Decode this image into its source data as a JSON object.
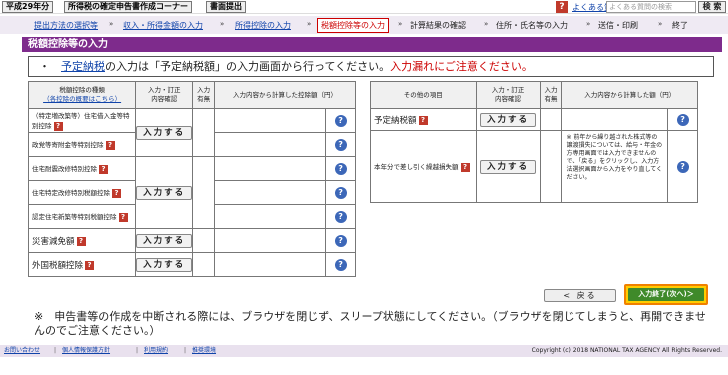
{
  "topbar": {
    "year_btn": "平成29年分",
    "corner_btn": "所得税の確定申告書作成コーナー",
    "print_btn": "書面提出",
    "faq_link": "よくある質問",
    "search_placeholder": "よくある質問の検索",
    "search_btn": "検 索"
  },
  "steps": [
    {
      "label": "提出方法の選択等",
      "state": "link"
    },
    {
      "label": "収入・所得金額の入力",
      "state": "link"
    },
    {
      "label": "所得控除の入力",
      "state": "link"
    },
    {
      "label": "税額控除等の入力",
      "state": "current"
    },
    {
      "label": "計算結果の確認",
      "state": "plain"
    },
    {
      "label": "住所・氏名等の入力",
      "state": "plain"
    },
    {
      "label": "送信・印刷",
      "state": "plain"
    },
    {
      "label": "終了",
      "state": "plain"
    }
  ],
  "page_title": "税額控除等の入力",
  "notice": {
    "bullet": "・",
    "link": "予定納税",
    "text": "の入力は「予定納税額」の入力画面から行ってください。",
    "warn": "入力漏れにご注意ください。"
  },
  "left_table": {
    "headers": {
      "kind": "税額控除の種類",
      "kind_link": "（各控除の概要はこちら）",
      "input": "入力・訂正\n内容確認",
      "status": "入力\n有無",
      "amount": "入力内容から計算した控除額（円）"
    },
    "rows": [
      {
        "label": "（特定増改築等）住宅借入金等特別控除"
      },
      {
        "label": "政党等寄附金等特別控除"
      },
      {
        "label": "住宅耐震改修特別控除"
      },
      {
        "label": "住宅特定改修特別税額控除"
      },
      {
        "label": "認定住宅新築等特別税額控除"
      },
      {
        "label": "災害減免額"
      },
      {
        "label": "外国税額控除"
      }
    ]
  },
  "right_table": {
    "headers": {
      "item": "その他の項目",
      "input": "入力・訂正\n内容確認",
      "status": "入力\n有無",
      "amount": "入力内容から計算した額（円）"
    },
    "rows": [
      {
        "label": "予定納税額"
      },
      {
        "label": "本年分で差し引く繰越損失額"
      }
    ],
    "note": "※ 前年から繰り越された株式等の譲渡損失については、給与・年金の方専用画面では入力できませんので、「戻る」をクリックし、入力方法選択画面から入力をやり直してください。"
  },
  "input_btn": "入力する",
  "help_icon": "?",
  "q_icon": "?",
  "back_btn": "< 戻る",
  "done_btn": "入力終了(次へ)＞",
  "bottom_note": "※　申告書等の作成を中断される際には、ブラウザを閉じず、スリープ状態にしてください。（ブラウザを閉じてしまうと、再開できませんのでご注意ください。）",
  "footer": {
    "links": [
      "お問い合わせ",
      "個人情報保護方針",
      "利用規約",
      "推奨環境"
    ],
    "copyright": "Copyright (c) 2018 NATIONAL TAX AGENCY All Rights Reserved."
  },
  "colors": {
    "accent": "#7e2b8c",
    "next_btn": "#3f8a2a",
    "highlight": "#f08000"
  }
}
